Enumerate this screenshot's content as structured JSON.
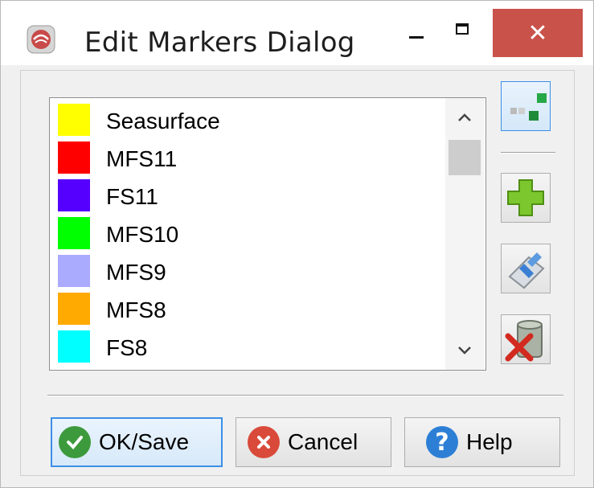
{
  "window": {
    "title": "Edit Markers Dialog",
    "close_glyph": "✕",
    "app_icon": "app-icon"
  },
  "markers": [
    {
      "label": "Seasurface",
      "color": "#ffff00"
    },
    {
      "label": "MFS11",
      "color": "#ff0000"
    },
    {
      "label": "FS11",
      "color": "#5500ff"
    },
    {
      "label": "MFS10",
      "color": "#00ff00"
    },
    {
      "label": "MFS9",
      "color": "#aaaaff"
    },
    {
      "label": "MFS8",
      "color": "#ffaa00"
    },
    {
      "label": "FS8",
      "color": "#00ffff"
    }
  ],
  "scrollbar": {
    "up_glyph": "⌃",
    "down_glyph": "⌄"
  },
  "side_tools": [
    "marker-style-icon",
    "add-icon",
    "edit-icon",
    "delete-icon"
  ],
  "buttons": {
    "ok": {
      "label": "OK/Save",
      "icon": "checkmark-icon",
      "color": "#3c9a3c"
    },
    "cancel": {
      "label": "Cancel",
      "icon": "cancel-icon",
      "color": "#d94a3a"
    },
    "help": {
      "label": "Help",
      "icon": "question-icon",
      "color": "#2d7fd6"
    }
  }
}
